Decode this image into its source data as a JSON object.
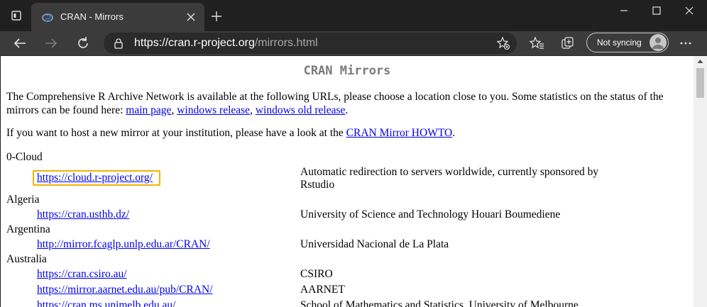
{
  "tab": {
    "title": "CRAN - Mirrors"
  },
  "omnibox": {
    "url_main": "https://cran.r-project.org",
    "url_path": "/mirrors.html"
  },
  "profile": {
    "label": "Not syncing"
  },
  "page": {
    "title": "CRAN Mirrors",
    "intro_text": "The Comprehensive R Archive Network is available at the following URLs, please choose a location close to you. Some statistics on the status of the mirrors can be found here: ",
    "link_main": "main page",
    "link_windows": "windows release",
    "link_windows_old": "windows old release",
    "sep_comma": ", ",
    "period": ".",
    "host_text": "If you want to host a new mirror at your institution, please have a look at the ",
    "link_howto": "CRAN Mirror HOWTO",
    "countries": [
      {
        "name": "0-Cloud"
      },
      {
        "name": "Algeria"
      },
      {
        "name": "Argentina"
      },
      {
        "name": "Australia"
      }
    ],
    "mirrors": [
      {
        "url": "https://cloud.r-project.org/",
        "desc": "Automatic redirection to servers worldwide, currently sponsored by Rstudio"
      },
      {
        "url": "https://cran.usthb.dz/",
        "desc": "University of Science and Technology Houari Boumediene"
      },
      {
        "url": "http://mirror.fcaglp.unlp.edu.ar/CRAN/",
        "desc": "Universidad Nacional de La Plata"
      },
      {
        "url": "https://cran.csiro.au/",
        "desc": "CSIRO"
      },
      {
        "url": "https://mirror.aarnet.edu.au/pub/CRAN/",
        "desc": "AARNET"
      },
      {
        "url": "https://cran.ms.unimelb.edu.au/",
        "desc": "School of Mathematics and Statistics, University of Melbourne"
      }
    ]
  }
}
